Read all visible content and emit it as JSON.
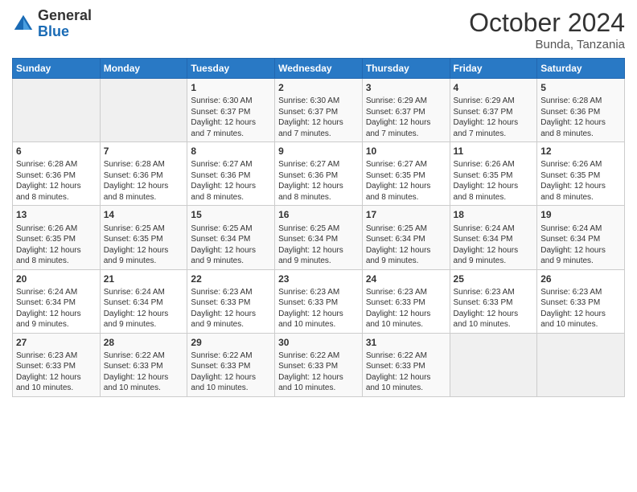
{
  "logo": {
    "general": "General",
    "blue": "Blue"
  },
  "header": {
    "month": "October 2024",
    "location": "Bunda, Tanzania"
  },
  "days": [
    "Sunday",
    "Monday",
    "Tuesday",
    "Wednesday",
    "Thursday",
    "Friday",
    "Saturday"
  ],
  "weeks": [
    [
      {
        "day": "",
        "content": ""
      },
      {
        "day": "",
        "content": ""
      },
      {
        "day": "1",
        "content": "Sunrise: 6:30 AM\nSunset: 6:37 PM\nDaylight: 12 hours and 7 minutes."
      },
      {
        "day": "2",
        "content": "Sunrise: 6:30 AM\nSunset: 6:37 PM\nDaylight: 12 hours and 7 minutes."
      },
      {
        "day": "3",
        "content": "Sunrise: 6:29 AM\nSunset: 6:37 PM\nDaylight: 12 hours and 7 minutes."
      },
      {
        "day": "4",
        "content": "Sunrise: 6:29 AM\nSunset: 6:37 PM\nDaylight: 12 hours and 7 minutes."
      },
      {
        "day": "5",
        "content": "Sunrise: 6:28 AM\nSunset: 6:36 PM\nDaylight: 12 hours and 8 minutes."
      }
    ],
    [
      {
        "day": "6",
        "content": "Sunrise: 6:28 AM\nSunset: 6:36 PM\nDaylight: 12 hours and 8 minutes."
      },
      {
        "day": "7",
        "content": "Sunrise: 6:28 AM\nSunset: 6:36 PM\nDaylight: 12 hours and 8 minutes."
      },
      {
        "day": "8",
        "content": "Sunrise: 6:27 AM\nSunset: 6:36 PM\nDaylight: 12 hours and 8 minutes."
      },
      {
        "day": "9",
        "content": "Sunrise: 6:27 AM\nSunset: 6:36 PM\nDaylight: 12 hours and 8 minutes."
      },
      {
        "day": "10",
        "content": "Sunrise: 6:27 AM\nSunset: 6:35 PM\nDaylight: 12 hours and 8 minutes."
      },
      {
        "day": "11",
        "content": "Sunrise: 6:26 AM\nSunset: 6:35 PM\nDaylight: 12 hours and 8 minutes."
      },
      {
        "day": "12",
        "content": "Sunrise: 6:26 AM\nSunset: 6:35 PM\nDaylight: 12 hours and 8 minutes."
      }
    ],
    [
      {
        "day": "13",
        "content": "Sunrise: 6:26 AM\nSunset: 6:35 PM\nDaylight: 12 hours and 8 minutes."
      },
      {
        "day": "14",
        "content": "Sunrise: 6:25 AM\nSunset: 6:35 PM\nDaylight: 12 hours and 9 minutes."
      },
      {
        "day": "15",
        "content": "Sunrise: 6:25 AM\nSunset: 6:34 PM\nDaylight: 12 hours and 9 minutes."
      },
      {
        "day": "16",
        "content": "Sunrise: 6:25 AM\nSunset: 6:34 PM\nDaylight: 12 hours and 9 minutes."
      },
      {
        "day": "17",
        "content": "Sunrise: 6:25 AM\nSunset: 6:34 PM\nDaylight: 12 hours and 9 minutes."
      },
      {
        "day": "18",
        "content": "Sunrise: 6:24 AM\nSunset: 6:34 PM\nDaylight: 12 hours and 9 minutes."
      },
      {
        "day": "19",
        "content": "Sunrise: 6:24 AM\nSunset: 6:34 PM\nDaylight: 12 hours and 9 minutes."
      }
    ],
    [
      {
        "day": "20",
        "content": "Sunrise: 6:24 AM\nSunset: 6:34 PM\nDaylight: 12 hours and 9 minutes."
      },
      {
        "day": "21",
        "content": "Sunrise: 6:24 AM\nSunset: 6:34 PM\nDaylight: 12 hours and 9 minutes."
      },
      {
        "day": "22",
        "content": "Sunrise: 6:23 AM\nSunset: 6:33 PM\nDaylight: 12 hours and 9 minutes."
      },
      {
        "day": "23",
        "content": "Sunrise: 6:23 AM\nSunset: 6:33 PM\nDaylight: 12 hours and 10 minutes."
      },
      {
        "day": "24",
        "content": "Sunrise: 6:23 AM\nSunset: 6:33 PM\nDaylight: 12 hours and 10 minutes."
      },
      {
        "day": "25",
        "content": "Sunrise: 6:23 AM\nSunset: 6:33 PM\nDaylight: 12 hours and 10 minutes."
      },
      {
        "day": "26",
        "content": "Sunrise: 6:23 AM\nSunset: 6:33 PM\nDaylight: 12 hours and 10 minutes."
      }
    ],
    [
      {
        "day": "27",
        "content": "Sunrise: 6:23 AM\nSunset: 6:33 PM\nDaylight: 12 hours and 10 minutes."
      },
      {
        "day": "28",
        "content": "Sunrise: 6:22 AM\nSunset: 6:33 PM\nDaylight: 12 hours and 10 minutes."
      },
      {
        "day": "29",
        "content": "Sunrise: 6:22 AM\nSunset: 6:33 PM\nDaylight: 12 hours and 10 minutes."
      },
      {
        "day": "30",
        "content": "Sunrise: 6:22 AM\nSunset: 6:33 PM\nDaylight: 12 hours and 10 minutes."
      },
      {
        "day": "31",
        "content": "Sunrise: 6:22 AM\nSunset: 6:33 PM\nDaylight: 12 hours and 10 minutes."
      },
      {
        "day": "",
        "content": ""
      },
      {
        "day": "",
        "content": ""
      }
    ]
  ]
}
